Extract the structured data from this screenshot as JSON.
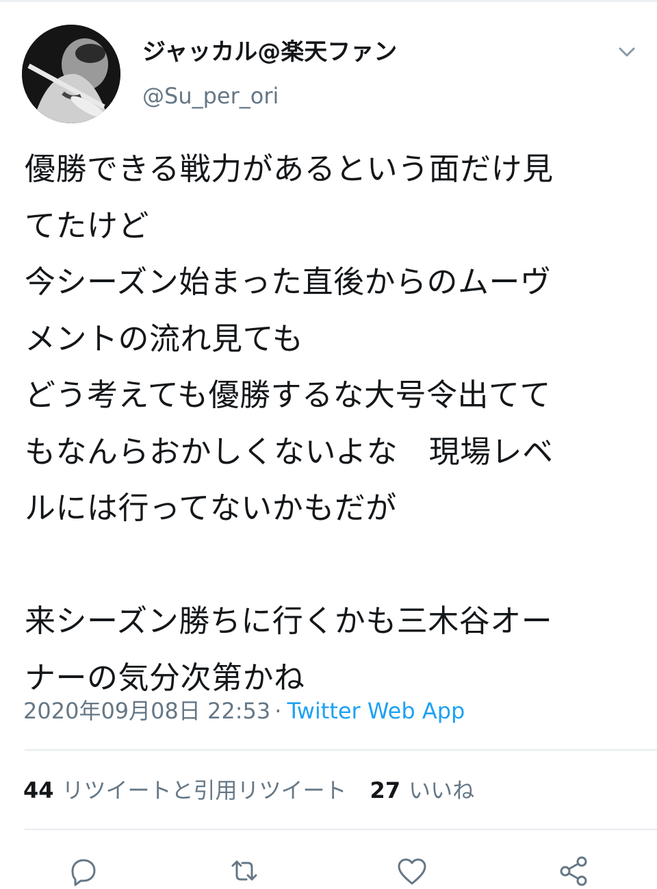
{
  "user": {
    "display_name": "ジャッカル@楽天ファン",
    "handle": "@Su_per_ori"
  },
  "tweet": {
    "lines": [
      "優勝できる戦力があるという面だけ見",
      "てたけど",
      "今シーズン始まった直後からのムーヴ",
      "メントの流れ見ても",
      "どう考えても優勝するな大号令出てて",
      "もなんらおかしくないよな　現場レベ",
      "ルには行ってないかもだが",
      "",
      "来シーズン勝ちに行くかも三木谷オー",
      "ナーの気分次第かね"
    ],
    "timestamp": "2020年09月08日 22:53",
    "separator": "·",
    "source": "Twitter Web App"
  },
  "stats": {
    "retweets_count": "44",
    "retweets_label": "リツイートと引用リツイート",
    "likes_count": "27",
    "likes_label": "いいね"
  },
  "icons": {
    "menu": "chevron-down-icon",
    "reply": "reply-icon",
    "retweet": "retweet-icon",
    "like": "heart-icon",
    "share": "share-icon"
  },
  "colors": {
    "text": "#14171a",
    "secondary": "#657786",
    "link": "#1da1f2",
    "divider": "#e6ecf0"
  }
}
